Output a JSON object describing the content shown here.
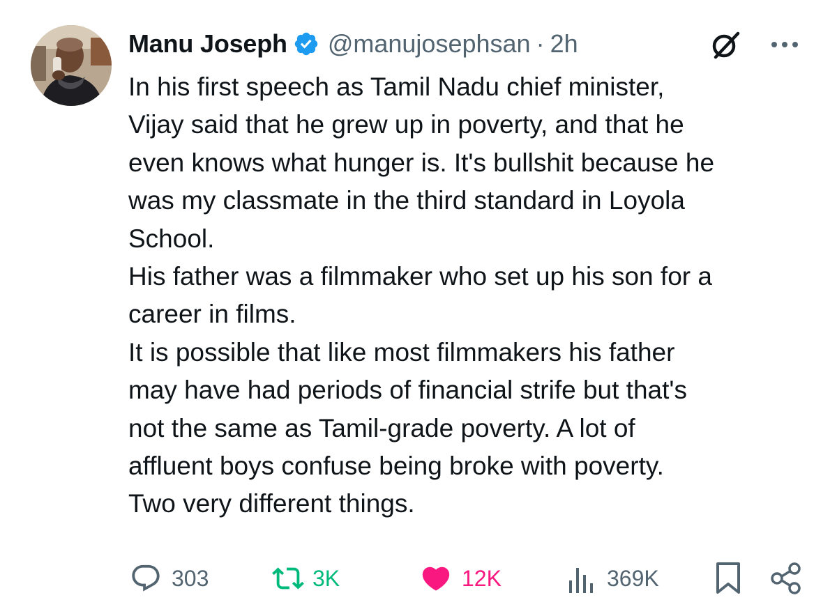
{
  "tweet": {
    "author": {
      "display_name": "Manu Joseph",
      "handle": "@manujosephsan",
      "separator": "·",
      "time": "2h",
      "verified": true
    },
    "body": [
      "In his first speech as Tamil Nadu chief minister,",
      "Vijay said that he grew up in poverty, and that he",
      "even knows what hunger is. It's bullshit because he",
      "was my classmate in the third standard in Loyola",
      "School.",
      "His father was a filmmaker who set up his son for a",
      "career in films.",
      "It is possible that like most filmmakers his father",
      "may have had periods of financial strife but that's",
      "not the same as Tamil-grade poverty. A lot of",
      "affluent boys confuse being broke with poverty.",
      "Two very different things."
    ],
    "actions": {
      "replies": "303",
      "reposts": "3K",
      "likes": "12K",
      "views": "369K"
    }
  },
  "icons": {
    "verified": "verified-badge-icon",
    "grok": "grok-icon",
    "more": "more-options-icon",
    "reply": "reply-bubble-icon",
    "repost": "repost-icon",
    "like": "heart-filled-icon",
    "views": "views-chart-icon",
    "bookmark": "bookmark-icon",
    "share": "share-icon"
  },
  "colors": {
    "text": "#0f1419",
    "secondary": "#536471",
    "verified_blue": "#1d9bf0",
    "repost_green": "#00ba7c",
    "like_pink": "#f91880"
  }
}
